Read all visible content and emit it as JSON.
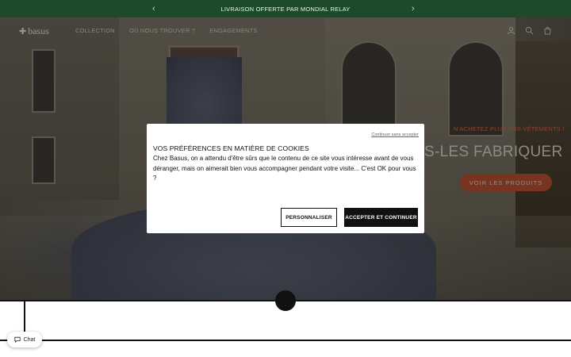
{
  "announcement": {
    "text": "LIVRAISON OFFERTE PAR MONDIAL RELAY",
    "prev_arrow": "‹",
    "next_arrow": "›"
  },
  "header": {
    "logo": "basus",
    "nav": [
      "COLLECTION",
      "OÙ NOUS TROUVER ?",
      "ENGAGEMENTS"
    ],
    "icons": [
      "user-icon",
      "search-icon",
      "cart-icon"
    ]
  },
  "hero": {
    "kicker": "N'ACHETEZ PLUS VOS VÊTEMENTS !",
    "title": "S-LES FABRIQUER",
    "cta": "VOIR LES PRODUITS"
  },
  "cookie_modal": {
    "skip_link": "Continuer sans accepter",
    "title": "VOS PRÉFÉRENCES EN MATIÈRE DE COOKIES",
    "body": "Chez Basus, on a attendu d'être sûrs que le contenu de ce site vous intéresse avant de vous déranger, mais on aimerait bien vous accompagner pendant votre visite... C'est OK pour vous ?",
    "customize_label": "PERSONNALISER",
    "accept_label": "ACCEPTER ET CONTINUER"
  },
  "chat": {
    "label": "Chat"
  },
  "colors": {
    "announcement_bg": "#1e4a2c",
    "accent": "#b8502f",
    "button_dark": "#111111"
  }
}
